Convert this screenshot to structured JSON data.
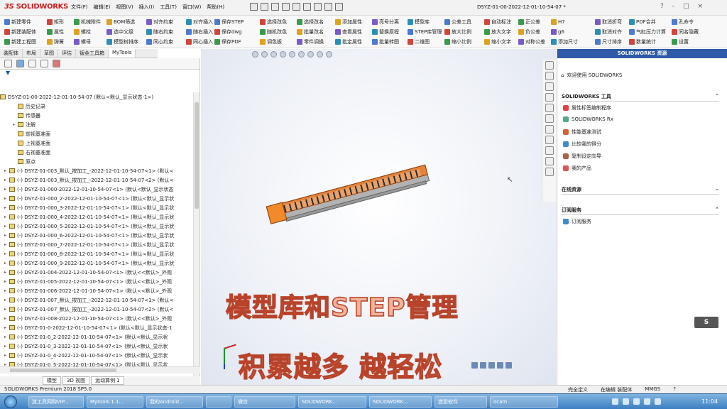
{
  "titlebar": {
    "logo": "SOLIDWORKS",
    "menu": [
      "文件(F)",
      "编辑(E)",
      "视图(V)",
      "插入(I)",
      "工具(T)",
      "窗口(W)",
      "帮助(H)"
    ],
    "document_title": "DSYZ-01-00-2022-12-01-10-54-07 *",
    "win_buttons": [
      "?",
      "-",
      "□",
      "×"
    ]
  },
  "ribbon": {
    "columns": [
      [
        "新建零件",
        "新建装配体",
        "新建工程图"
      ],
      [
        "矩形",
        "属性",
        "弹簧"
      ],
      [
        "机械附件",
        "螺栓",
        "螺母"
      ],
      [
        "BOM筛选",
        "选中父级",
        "模型树排序"
      ],
      [
        "对齐约束",
        "随右约束",
        "同心约束"
      ],
      [
        "对齐插入",
        "随右插入",
        "同心插入"
      ],
      [
        "保存STEP",
        "保存dwg",
        "保存PDF"
      ],
      [
        "选择改色",
        "随机改色",
        "调色板"
      ],
      [
        "选择改名",
        "批量改名",
        "零件调换"
      ],
      [
        "添加属性",
        "查看属性",
        "批定属性"
      ],
      [
        "亮号分离",
        "替换原程",
        "批量转图"
      ],
      [
        "模型库",
        "STEP库管理",
        "二维图"
      ],
      [
        "公差工具",
        "放大比例",
        "缩小比例"
      ],
      [
        "自动标注",
        "放大文字",
        "缩小文字"
      ],
      [
        "正公差",
        "负公差",
        "对称公差"
      ],
      [
        "H7",
        "g6",
        "添加尺寸"
      ],
      [
        "取消折弯",
        "取消对齐",
        "尺寸排序"
      ],
      [
        "PDF合并",
        "气缸压力计算",
        "数量统计"
      ],
      [
        "孔命令",
        "同名隐藏",
        "设置"
      ]
    ]
  },
  "tabs": [
    "装配体",
    "布局",
    "草图",
    "评估",
    "钣金工具箱",
    "MyTools"
  ],
  "tree": {
    "root": "DSYZ-01-00-2022-12-01-10-54-07 (默认<默认_显示状态-1>)",
    "items": [
      "历史记录",
      "传感器",
      "注解",
      "前视基准面",
      "上视基准面",
      "右视基准面",
      "原点",
      "(-) DSYZ-01-003_默认_按加工_-2022-12-01-10-54-07<1> (默认<",
      "(-) DSYZ-01-003_默认_按加工_-2022-12-01-10-54-07<2> (默认<",
      "(-) DSYZ-01-000-2022-12-01-10-54-07<1> (默认<默认_显示状态",
      "(-) DSYZ-01-000_2-2022-12-01-10-54-07<1> (默认<默认_显示状",
      "(-) DSYZ-01-000_3-2022-12-01-10-54-07<1> (默认<默认_显示状",
      "(-) DSYZ-01-000_4-2022-12-01-10-54-07<1> (默认<默认_显示状",
      "(-) DSYZ-01-000_5-2022-12-01-10-54-07<1> (默认<默认_显示状",
      "(-) DSYZ-01-000_6-2022-12-01-10-54-07<1> (默认<默认_显示状",
      "(-) DSYZ-01-000_7-2022-12-01-10-54-07<1> (默认<默认_显示状",
      "(-) DSYZ-01-000_8-2022-12-01-10-54-07<1> (默认<默认_显示状",
      "(-) DSYZ-01-000_9-2022-12-01-10-54-07<1> (默认<默认_显示状",
      "(-) DSYZ-01-004-2022-12-01-10-54-07<1> (默认<<默认>_外观",
      "(-) DSYZ-01-005-2022-12-01-10-54-07<1> (默认<<默认>_外观",
      "(-) DSYZ-01-006-2022-12-01-10-54-07<1> (默认<<默认>_外观",
      "(-) DSYZ-01-007_默认_按加工_-2022-12-01-10-54-07<1> (默认<",
      "(-) DSYZ-01-007_默认_按加工_-2022-12-01-10-54-07<2> (默认<",
      "(-) DSYZ-01-008-2022-12-01-10-54-07<1> (默认<<默认>_外观",
      "(-) DSYZ-01-0-2022-12-01-10-54-07<1> (默认<默认_显示状态-1",
      "(-) DSYZ-01-0_2-2022-12-01-10-54-07<1> (默认<默认_显示状",
      "(-) DSYZ-01-0_3-2022-12-01-10-54-07<1> (默认<默认_显示状",
      "(-) DSYZ-01-0_4-2022-12-01-10-54-07<1> (默认<默认_显示状",
      "(-) DSYZ-01-0_5-2022-12-01-10-54-07<1> (默认<默认_显示状"
    ]
  },
  "bottom_tabs": [
    "模型",
    "3D 视图",
    "运动算例 1"
  ],
  "overlay": {
    "caption_1": "模型库和STEP管理",
    "caption_2": "积累越多  越轻松",
    "badge": "S"
  },
  "resources": {
    "header": "SOLIDWORKS 资源",
    "welcome": "欢迎使用 SOLIDWORKS",
    "tools_title": "SOLIDWORKS 工具",
    "tools": [
      "属性标签编制程序",
      "SOLIDWORKS Rx",
      "性能基准测试",
      "比较我的得分",
      "复制设定向导",
      "我的产品"
    ],
    "online_title": "在线资源",
    "subs_title": "订阅服务",
    "subs_item": "订阅服务"
  },
  "status": {
    "left": "SOLIDWORKS Premium 2018 SP5.0",
    "right": [
      "完全定义",
      "在编辑 装配体",
      "MMGS",
      "?"
    ]
  },
  "taskbar": {
    "items": [
      "迷工具网购VIP...",
      "Mytools 1.1...",
      "我的Android...",
      "微信",
      "SOLIDWORK...",
      "SOLIDWORK...",
      "造型软件",
      "ocam"
    ],
    "clock": "11:04"
  }
}
